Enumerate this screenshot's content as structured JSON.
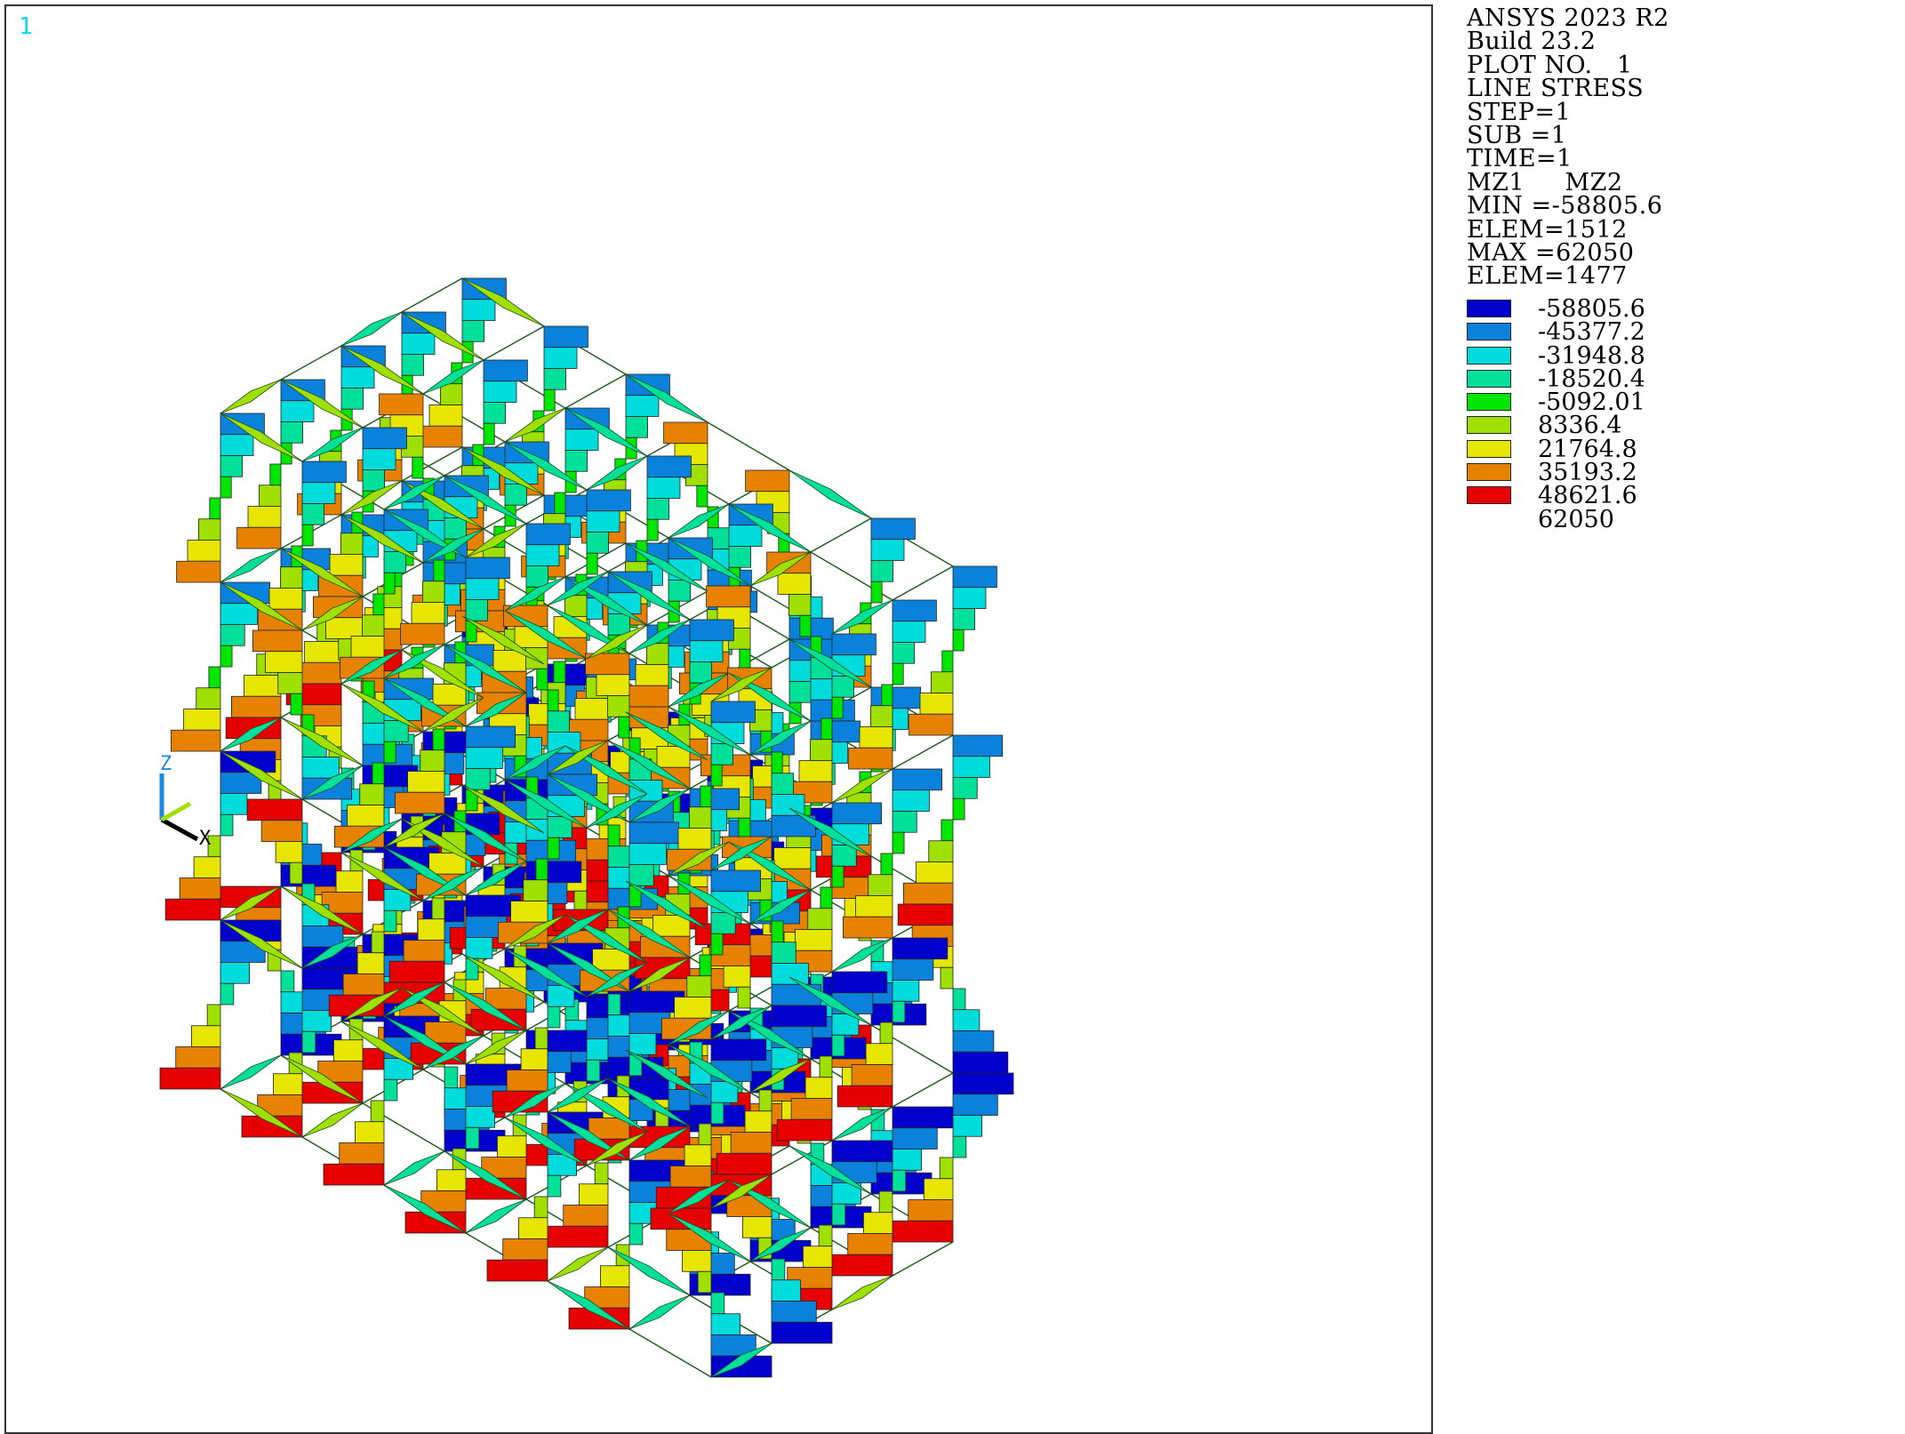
{
  "window_number": "1",
  "info": {
    "program": "ANSYS 2023 R2",
    "build": "Build 23.2",
    "plot_no": "PLOT NO.   1",
    "plot_type": "LINE STRESS",
    "step": "STEP=1",
    "sub": "SUB =1",
    "time": "TIME=1",
    "items": "MZ1     MZ2",
    "min": "MIN =-58805.6",
    "min_elem": "ELEM=1512",
    "max": "MAX =62050",
    "max_elem": "ELEM=1477"
  },
  "legend": [
    {
      "value": "-58805.6",
      "color": "#0000cc"
    },
    {
      "value": "-45377.2",
      "color": "#0a82dc"
    },
    {
      "value": "-31948.8",
      "color": "#00dcdc"
    },
    {
      "value": "-18520.4",
      "color": "#00e09a"
    },
    {
      "value": "-5092.01",
      "color": "#00e600"
    },
    {
      "value": "8336.4",
      "color": "#a0e000"
    },
    {
      "value": "21764.8",
      "color": "#e6e600"
    },
    {
      "value": "35193.2",
      "color": "#e68200"
    },
    {
      "value": "48621.6",
      "color": "#e60000"
    },
    {
      "value": "62050",
      "color": ""
    }
  ],
  "triad": {
    "z_label": "Z",
    "x_label": "X"
  }
}
